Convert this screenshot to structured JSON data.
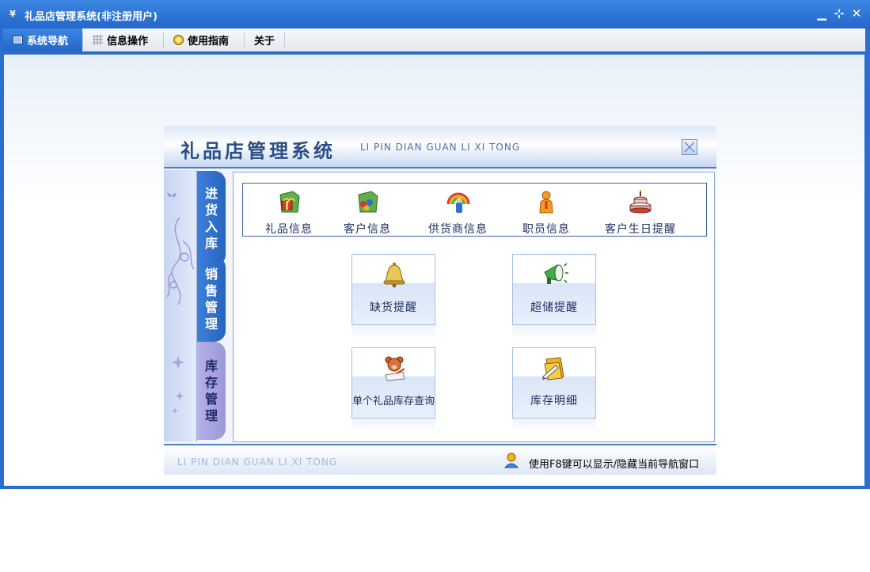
{
  "window": {
    "title": "礼品店管理系统(非注册用户)",
    "controls": {
      "minimize": "▁",
      "restore": "⊹",
      "close": "✕"
    }
  },
  "menubar": {
    "items": [
      {
        "label": "系统导航",
        "icon": "window-icon",
        "active": true
      },
      {
        "label": "信息操作",
        "icon": "grid-icon",
        "active": false
      },
      {
        "label": "使用指南",
        "icon": "help-circle-icon",
        "active": false
      },
      {
        "label": "关于",
        "icon": "",
        "active": false
      }
    ]
  },
  "panel": {
    "title": "礼品店管理系统",
    "subtitle": "LI PIN DIAN GUAN LI XI TONG",
    "vertical_tabs": [
      {
        "label": [
          "进",
          "货",
          "入",
          "库"
        ],
        "color": "#2f70cc"
      },
      {
        "label": [
          "销",
          "售",
          "管",
          "理"
        ],
        "color": "#2f70cc"
      },
      {
        "label": [
          "库",
          "存",
          "管",
          "理"
        ],
        "color": "#a9a3e0"
      }
    ],
    "top_items": [
      {
        "label": "礼品信息",
        "icon": "gift-folder-icon"
      },
      {
        "label": "客户信息",
        "icon": "customer-folder-icon"
      },
      {
        "label": "供货商信息",
        "icon": "supplier-icon"
      },
      {
        "label": "职员信息",
        "icon": "staff-icon"
      },
      {
        "label": "客户生日提醒",
        "icon": "birthday-cake-icon"
      }
    ],
    "tiles": [
      {
        "label": "缺货提醒",
        "icon": "bell-icon"
      },
      {
        "label": "超储提醒",
        "icon": "megaphone-icon"
      },
      {
        "label": "单个礼品库存查询",
        "icon": "teddy-bear-icon"
      },
      {
        "label": "库存明细",
        "icon": "folder-pencil-icon"
      }
    ],
    "footer": {
      "left_text": "LI PIN DIAN GUAN LI XI TONG",
      "hint": "使用F8键可以显示/隐藏当前导航窗口"
    }
  },
  "colors": {
    "title_bar": "#2a6fd0",
    "accent": "#2c6cc7",
    "inactive_tab": "#a9a3e0"
  }
}
